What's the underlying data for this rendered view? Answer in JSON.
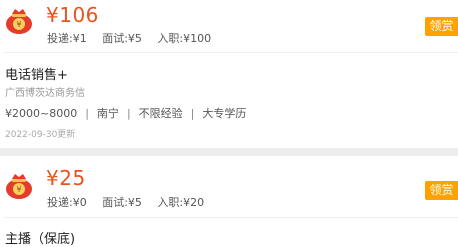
{
  "colors": {
    "price": "#e8541e",
    "claim_button": "#ffa200",
    "separator": "#eeeeee"
  },
  "jobs": [
    {
      "price": "¥106",
      "deliver": "投递:¥1",
      "interview": "面试:¥5",
      "onboard": "入职:¥100",
      "claim_label": "领赏",
      "title": "电话销售+",
      "company": "广西博茨达商务信",
      "salary": "¥2000~8000",
      "location": "南宁",
      "experience": "不限经验",
      "education": "大专学历",
      "updated": "2022-09-30更新"
    },
    {
      "price": "¥25",
      "deliver": "投递:¥0",
      "interview": "面试:¥5",
      "onboard": "入职:¥20",
      "claim_label": "领赏",
      "title": "主播（保底)"
    }
  ]
}
